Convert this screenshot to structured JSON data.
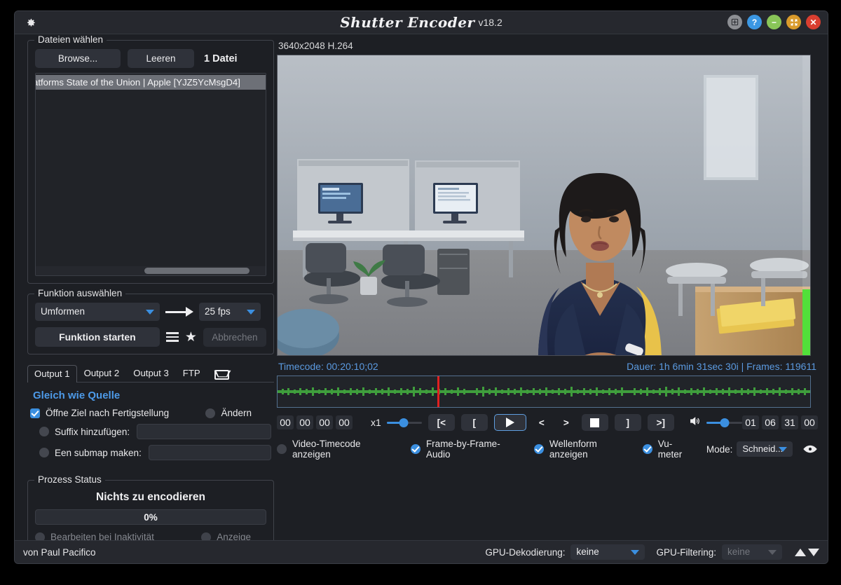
{
  "window": {
    "title": "Shutter Encoder",
    "version": "v18.2",
    "gear_icon": "gear-icon",
    "controls": [
      {
        "name": "window-restore-button",
        "glyph": "⧉",
        "color": "#8d8f94"
      },
      {
        "name": "help-button",
        "glyph": "?",
        "color": "#3b97e3"
      },
      {
        "name": "minimize-button",
        "glyph": "−",
        "color": "#89c558"
      },
      {
        "name": "maximize-button",
        "glyph": "✥",
        "color": "#d99a2b"
      },
      {
        "name": "close-button",
        "glyph": "✕",
        "color": "#d93e30"
      }
    ]
  },
  "files_panel": {
    "legend": "Dateien wählen",
    "browse_label": "Browse...",
    "clear_label": "Leeren",
    "count_label": "1 Datei",
    "items": [
      "atforms State of the Union  |  Apple [YJZ5YcMsgD4]"
    ]
  },
  "function_panel": {
    "legend": "Funktion auswählen",
    "function_value": "Umformen",
    "fps_value": "25 fps",
    "start_label": "Funktion starten",
    "cancel_label": "Abbrechen",
    "menu_icon": "hamburger-icon",
    "favorite_icon": "star-icon",
    "arrow_icon": "arrow-right-icon"
  },
  "output_panel": {
    "tabs": [
      {
        "label": "Output 1",
        "active": true
      },
      {
        "label": "Output 2",
        "active": false
      },
      {
        "label": "Output 3",
        "active": false
      },
      {
        "label": "FTP",
        "active": false
      }
    ],
    "mail_icon": "envelope-icon",
    "same_as_source": "Gleich wie Quelle",
    "open_target_label": "Öffne Ziel nach Fertigstellung",
    "change_label": "Ändern",
    "suffix_label": "Suffix hinzufügen:",
    "suffix_value": "",
    "submap_label": "Een submap maken:",
    "submap_value": ""
  },
  "status_panel": {
    "legend": "Prozess Status",
    "status_text": "Nichts zu encodieren",
    "progress_text": "0%",
    "progress_percent": 0,
    "idle_label": "Bearbeiten bei Inaktivität",
    "display_label": "Anzeige"
  },
  "player": {
    "resolution": "3640x2048 H.264",
    "timecode": "Timecode: 00:20:10;02",
    "duration": "Dauer: 1h 6min 31sec 30i | Frames: 119611",
    "vu_level_percent": 22,
    "playhead_percent": 30,
    "waveform_color": "#3f9e3c",
    "playhead_color": "#e02020",
    "start_timecode": [
      "00",
      "00",
      "00",
      "00"
    ],
    "end_timecode": [
      "01",
      "06",
      "31",
      "00"
    ],
    "speed_label": "x1",
    "speed_percent": 48,
    "volume_percent": 52,
    "volume_icon": "speaker-icon",
    "buttons": [
      {
        "name": "go-to-in-point-button",
        "label": "[<"
      },
      {
        "name": "set-in-point-button",
        "label": "["
      },
      {
        "name": "play-button",
        "label": "play-icon"
      },
      {
        "name": "step-back-button",
        "label": "<"
      },
      {
        "name": "step-forward-button",
        "label": ">"
      },
      {
        "name": "stop-button",
        "label": "stop-icon"
      },
      {
        "name": "set-out-point-button",
        "label": "]"
      },
      {
        "name": "go-to-out-point-button",
        "label": ">]"
      }
    ],
    "options": [
      {
        "name": "show-video-timecode",
        "label": "Video-Timecode anzeigen",
        "checked": false
      },
      {
        "name": "frame-by-frame-audio",
        "label": "Frame-by-Frame-Audio",
        "checked": true
      },
      {
        "name": "show-waveform",
        "label": "Wellenform anzeigen",
        "checked": true
      },
      {
        "name": "vu-meter",
        "label": "Vu-meter",
        "checked": true
      }
    ],
    "mode_label": "Mode:",
    "mode_value": "Schneid...",
    "eye_icon": "eye-icon"
  },
  "bottom_bar": {
    "credit": "von Paul Pacifico",
    "gpu_decoding_label": "GPU-Dekodierung:",
    "gpu_decoding_value": "keine",
    "gpu_filtering_label": "GPU-Filtering:",
    "gpu_filtering_value": "keine",
    "scroll_up_icon": "triangle-up-icon",
    "scroll_down_icon": "triangle-down-icon"
  },
  "colors": {
    "accent": "#3b8fe0",
    "link": "#4d9ae8",
    "waveform": "#3f9e3c",
    "vu": "#52e03a"
  }
}
